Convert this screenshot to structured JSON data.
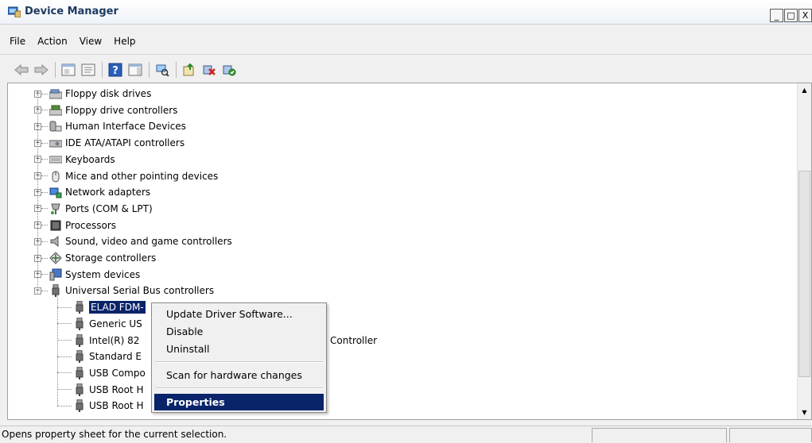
{
  "window": {
    "title": "Device Manager",
    "minimize": "_",
    "maximize": "□",
    "close": "X"
  },
  "menubar": {
    "items": [
      {
        "label": "File"
      },
      {
        "label": "Action"
      },
      {
        "label": "View"
      },
      {
        "label": "Help"
      }
    ]
  },
  "toolbar": {
    "buttons": [
      {
        "icon": "back-arrow-icon"
      },
      {
        "icon": "forward-arrow-icon"
      },
      {
        "icon": "show-hide-tree-icon"
      },
      {
        "icon": "properties-icon"
      },
      {
        "icon": "help-icon"
      },
      {
        "icon": "action-pane-icon"
      },
      {
        "icon": "scan-hardware-icon"
      },
      {
        "icon": "update-driver-icon"
      },
      {
        "icon": "uninstall-device-icon"
      },
      {
        "icon": "enable-device-icon"
      }
    ]
  },
  "tree": {
    "categories": [
      {
        "label": "Floppy disk drives",
        "icon": "floppy-disk-icon"
      },
      {
        "label": "Floppy drive controllers",
        "icon": "floppy-controller-icon"
      },
      {
        "label": "Human Interface Devices",
        "icon": "hid-icon"
      },
      {
        "label": "IDE ATA/ATAPI controllers",
        "icon": "ide-controller-icon"
      },
      {
        "label": "Keyboards",
        "icon": "keyboard-icon"
      },
      {
        "label": "Mice and other pointing devices",
        "icon": "mouse-icon"
      },
      {
        "label": "Network adapters",
        "icon": "network-adapter-icon"
      },
      {
        "label": "Ports (COM & LPT)",
        "icon": "port-icon"
      },
      {
        "label": "Processors",
        "icon": "processor-icon"
      },
      {
        "label": "Sound, video and game controllers",
        "icon": "sound-icon"
      },
      {
        "label": "Storage controllers",
        "icon": "storage-controller-icon"
      },
      {
        "label": "System devices",
        "icon": "system-devices-icon"
      },
      {
        "label": "Universal Serial Bus controllers",
        "icon": "usb-icon",
        "expanded": true
      }
    ],
    "usb_children": [
      {
        "label": "ELAD FDM-",
        "selected": true
      },
      {
        "label": "Generic US"
      },
      {
        "label": "Intel(R) 82",
        "suffix": "Controller"
      },
      {
        "label": "Standard E"
      },
      {
        "label": "USB Compo"
      },
      {
        "label": "USB Root H"
      },
      {
        "label": "USB Root H"
      }
    ],
    "expander_collapsed": "+",
    "expander_expanded": "−"
  },
  "context_menu": {
    "items": [
      {
        "label": "Update Driver Software..."
      },
      {
        "label": "Disable"
      },
      {
        "label": "Uninstall"
      },
      {
        "label": "Scan for hardware changes"
      },
      {
        "label": "Properties",
        "default": true
      }
    ]
  },
  "statusbar": {
    "text": "Opens property sheet for the current selection."
  },
  "colors": {
    "selection": "#0a246a",
    "title_text": "#1e3a60"
  }
}
